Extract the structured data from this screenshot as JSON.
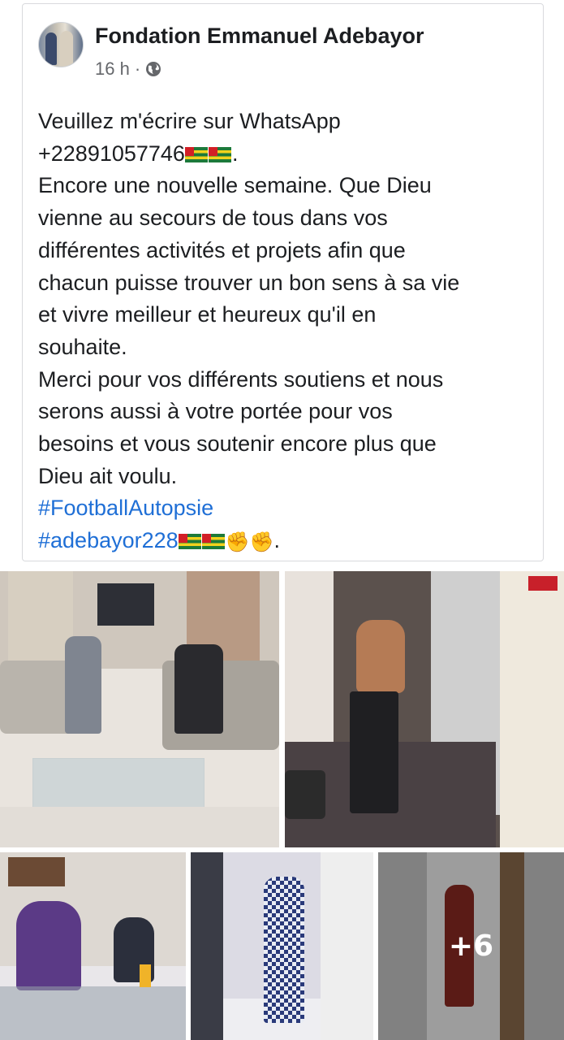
{
  "post": {
    "page_name": "Fondation Emmanuel Adebayor",
    "timestamp": "16 h",
    "separator": "·",
    "audience_icon": "globe-icon",
    "lines": [
      "Veuillez m'écrire sur WhatsApp",
      "+22891057746",
      "Encore une nouvelle semaine. Que Dieu",
      "vienne au secours de tous dans vos",
      "différentes activités et projets afin que",
      "chacun puisse trouver un bon sens à sa vie",
      "et vivre meilleur et heureux qu'il en",
      "souhaite.",
      "Merci pour vos différents soutiens et nous",
      "serons aussi à votre portée pour vos",
      "besoins et vous soutenir encore plus que",
      "Dieu ait voulu."
    ],
    "phone_suffix": ".",
    "hashtags": [
      "#FootballAutopsie",
      "#adebayor228"
    ],
    "hashtag_suffix": ".",
    "emoji": [
      "togo-flag-icon",
      "fist-icon"
    ]
  },
  "photos": {
    "more_count": "+6"
  },
  "colors": {
    "text": "#1c1e21",
    "meta": "#65676b",
    "hashtag": "#1f6fd6"
  }
}
